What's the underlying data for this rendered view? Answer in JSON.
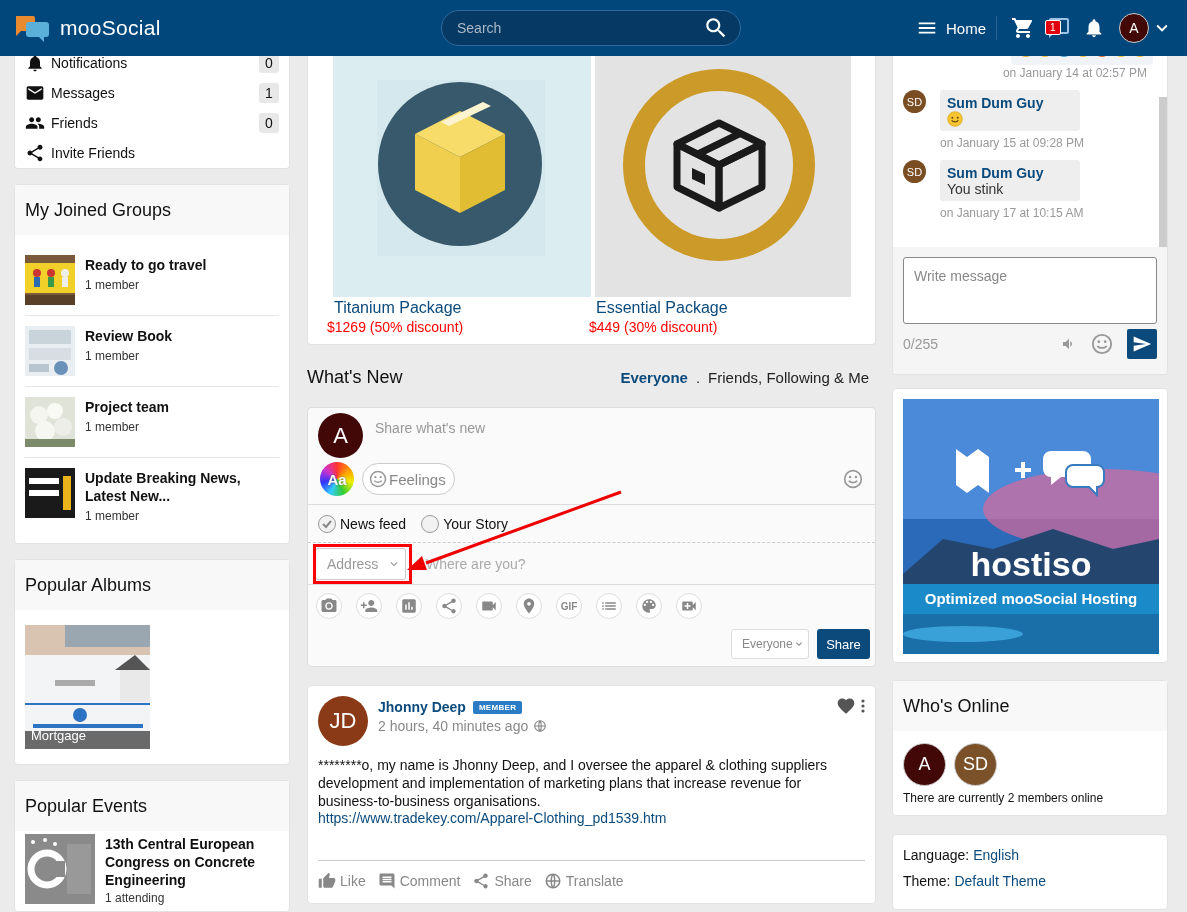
{
  "header": {
    "brand": "mooSocial",
    "search": {
      "placeholder": "Search"
    },
    "home": "Home",
    "message_badge": "1",
    "avatar": "A"
  },
  "left": {
    "menu": [
      {
        "label": "Notifications",
        "count": "0"
      },
      {
        "label": "Messages",
        "count": "1"
      },
      {
        "label": "Friends",
        "count": "0"
      },
      {
        "label": "Invite Friends"
      }
    ],
    "groups": {
      "title": "My Joined Groups",
      "items": [
        {
          "name": "Ready to go travel",
          "meta": "1 member"
        },
        {
          "name": "Review Book",
          "meta": "1 member"
        },
        {
          "name": "Project team",
          "meta": "1 member"
        },
        {
          "name": "Update Breaking News, Latest New...",
          "meta": "1 member"
        }
      ]
    },
    "albums": {
      "title": "Popular Albums",
      "items": [
        {
          "caption": "Mortgage"
        }
      ]
    },
    "events": {
      "title": "Popular Events",
      "items": [
        {
          "name": "13th Central European Congress on Concrete Engineering",
          "meta": "1 attending"
        }
      ]
    }
  },
  "center": {
    "packages": [
      {
        "kind": "box",
        "name": "Titanium Package",
        "price": "$1269 (50% discount)"
      },
      {
        "kind": "outline",
        "name": "Essential Package",
        "price": "$449 (30% discount)"
      }
    ],
    "feed": {
      "title": "What's New",
      "separator": ".",
      "filters": [
        {
          "label": "Everyone",
          "selected": true
        },
        {
          "label": "Friends, Following & Me",
          "selected": false
        }
      ]
    },
    "composer": {
      "avatar": "A",
      "placeholder": "Share what's new",
      "text_style": "Aa",
      "feelings": "Feelings",
      "targets": [
        {
          "label": "News feed",
          "selected": true
        },
        {
          "label": "Your Story",
          "selected": false
        }
      ],
      "address": "Address",
      "location": {
        "placeholder": "Where are you?"
      },
      "tools": [
        {
          "kind": "camera"
        },
        {
          "kind": "tag"
        },
        {
          "kind": "poll"
        },
        {
          "kind": "share"
        },
        {
          "kind": "video"
        },
        {
          "kind": "place"
        },
        {
          "kind": "gif",
          "label": "GIF"
        },
        {
          "kind": "list"
        },
        {
          "kind": "palette"
        },
        {
          "kind": "videoadd"
        }
      ],
      "privacy": "Everyone",
      "share": "Share"
    },
    "post": {
      "initials": "JD",
      "author": "Jhonny Deep",
      "badge": "MEMBER",
      "time": "2 hours, 40 minutes ago",
      "liked": true,
      "text": "********o, my name is Jhonny Deep, and I oversee the apparel & clothing suppliers development and implementation of marketing plans that increase revenue for business-to-business organisations.",
      "link": "https://www.tradekey.com/Apparel-Clothing_pd1539.htm",
      "actions": [
        {
          "kind": "like",
          "label": "Like"
        },
        {
          "kind": "comment",
          "label": "Comment"
        },
        {
          "kind": "share",
          "label": "Share"
        },
        {
          "kind": "translate",
          "label": "Translate"
        }
      ]
    }
  },
  "right": {
    "chat": {
      "first_time": "on January 14 at 02:57 PM",
      "messages": [
        {
          "initials": "SD",
          "sender": "Sum Dum Guy",
          "kind": "emoji",
          "time": "on January 15 at 09:28 PM"
        },
        {
          "initials": "SD",
          "sender": "Sum Dum Guy",
          "kind": "text",
          "text": "You stink",
          "time": "on January 17 at 10:15 AM"
        }
      ],
      "input": {
        "placeholder": "Write message"
      },
      "counter": "0/255"
    },
    "ad": {
      "brand": "hostiso",
      "tagline": "Optimized mooSocial Hosting"
    },
    "online": {
      "title": "Who's Online",
      "users": [
        {
          "initials": "A",
          "color": "#420808"
        },
        {
          "initials": "SD",
          "color": "#7a5128"
        }
      ],
      "summary": "There are currently 2 members online"
    },
    "settings": [
      {
        "label": "Language:",
        "value": "English"
      },
      {
        "label": "Theme:",
        "value": "Default Theme"
      }
    ]
  }
}
